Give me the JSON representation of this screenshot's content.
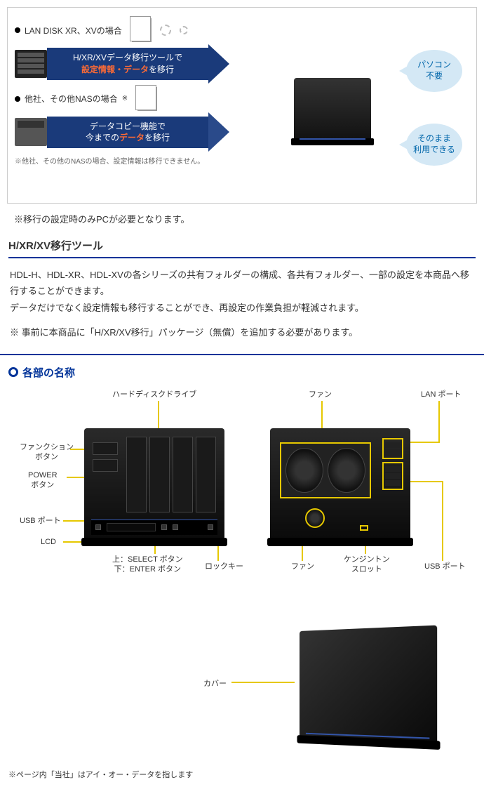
{
  "diagram": {
    "case1_label": "LAN DISK XR、XVの場合",
    "arrow1_line1": "H/XR/XVデータ移行ツールで",
    "arrow1_highlight": "設定情報・データ",
    "arrow1_line2_suffix": "を移行",
    "case2_label": "他社、その他NASの場合",
    "case2_sup": "※",
    "arrow2_line1": "データコピー機能で",
    "arrow2_prefix": "今までの",
    "arrow2_highlight": "データ",
    "arrow2_suffix": "を移行",
    "callout1": "パソコン\n不要",
    "callout2": "そのまま\n利用できる",
    "footnote": "※他社、その他のNASの場合、設定情報は移行できません。"
  },
  "note1": "※移行の設定時のみPCが必要となります。",
  "section_tool": {
    "title": "H/XR/XV移行ツール",
    "body1": "HDL-H、HDL-XR、HDL-XVの各シリーズの共有フォルダーの構成、各共有フォルダー、一部の設定を本商品へ移行することができます。\nデータだけでなく設定情報も移行することができ、再設定の作業負担が軽減されます。",
    "body2": "※ 事前に本商品に「H/XR/XV移行」パッケージ（無償）を追加する必要があります。"
  },
  "parts": {
    "title": "各部の名称",
    "labels": {
      "hdd": "ハードディスクドライブ",
      "fan": "ファン",
      "lan": "LAN ポート",
      "func": "ファンクション\nボタン",
      "power": "POWER\nボタン",
      "usb": "USB ポート",
      "lcd": "LCD",
      "select": "上：SELECT ボタン\n下：ENTER  ボタン",
      "lock": "ロックキー",
      "kensington": "ケンジントン\nスロット",
      "usb_back": "USB ポート",
      "cover": "カバー"
    }
  },
  "footer": "※ページ内「当社」はアイ・オー・データを指します"
}
